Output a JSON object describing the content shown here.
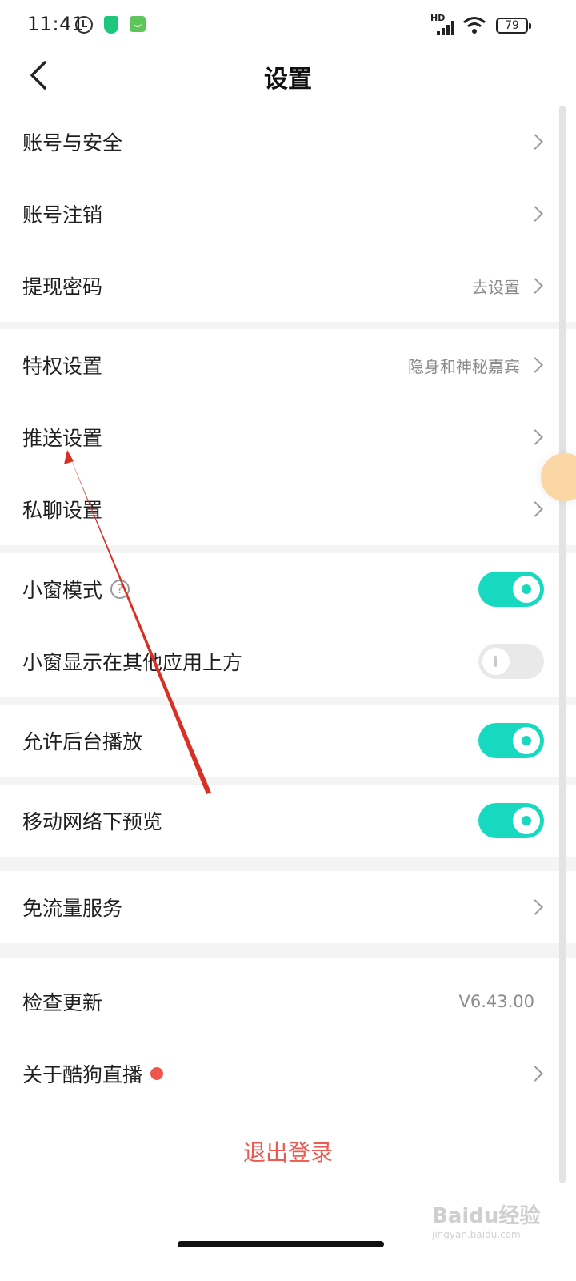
{
  "status_bar": {
    "time": "11:41",
    "network_badge": "HD",
    "battery": "79"
  },
  "header": {
    "title": "设置"
  },
  "group1": [
    {
      "label": "账号与安全",
      "value": ""
    },
    {
      "label": "账号注销",
      "value": ""
    },
    {
      "label": "提现密码",
      "value": "去设置"
    }
  ],
  "group2": [
    {
      "label": "特权设置",
      "value": "隐身和神秘嘉宾"
    },
    {
      "label": "推送设置",
      "value": ""
    },
    {
      "label": "私聊设置",
      "value": ""
    }
  ],
  "group3": [
    {
      "label": "小窗模式",
      "help": "?",
      "toggle": true
    },
    {
      "label": "小窗显示在其他应用上方",
      "toggle": false
    }
  ],
  "group4": {
    "label": "允许后台播放",
    "toggle": true
  },
  "group5": {
    "label": "移动网络下预览",
    "toggle": true
  },
  "group6": {
    "label": "免流量服务"
  },
  "group7": [
    {
      "label": "检查更新",
      "value": "V6.43.00"
    },
    {
      "label": "关于酷狗直播"
    }
  ],
  "logout": {
    "label": "退出登录"
  },
  "watermark": {
    "text": "Baidu经验",
    "url": "jingyan.baidu.com"
  },
  "colors": {
    "accent": "#17d9c0",
    "logout": "#ee5a52",
    "red_dot": "#f0544b",
    "annotation": "#d93025"
  }
}
